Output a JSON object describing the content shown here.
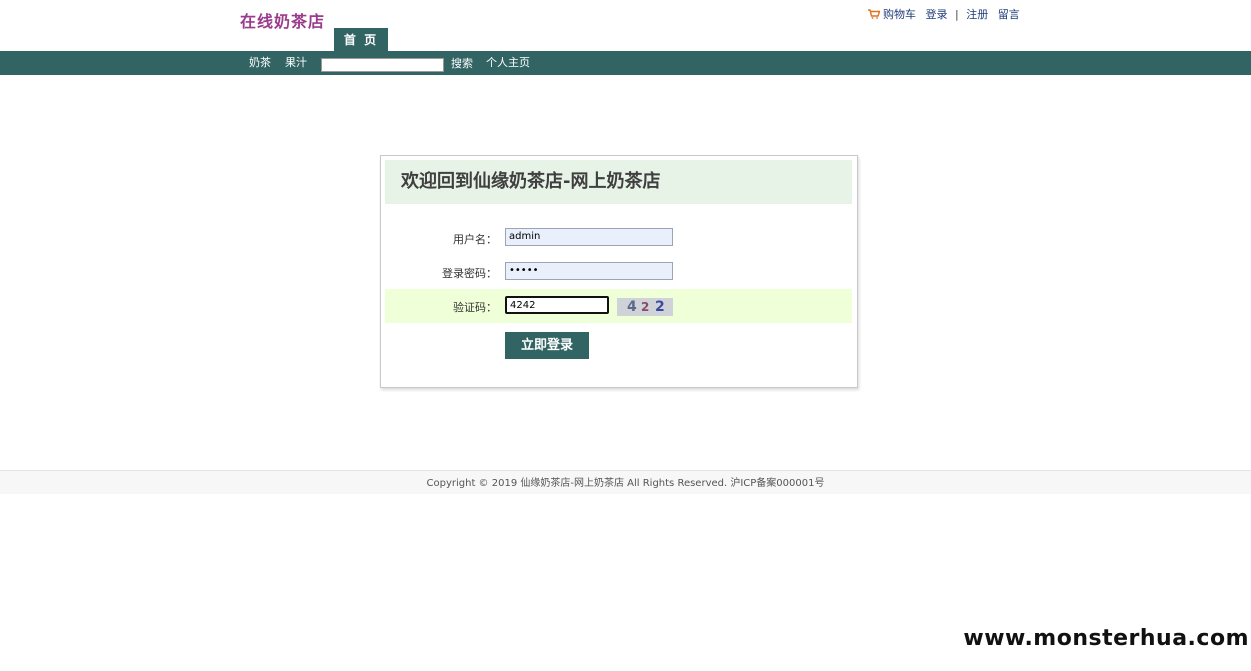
{
  "header": {
    "logo": "在线奶茶店",
    "top_links": {
      "cart": "购物车",
      "login": "登录",
      "separator": "|",
      "register": "注册",
      "message": "留言"
    },
    "home_tab": "首 页"
  },
  "nav": {
    "items": [
      "奶茶",
      "果汁"
    ],
    "search_value": "",
    "search_button": "搜索",
    "profile": "个人主页"
  },
  "login": {
    "title": "欢迎回到仙缘奶茶店-网上奶茶店",
    "username_label": "用户名：",
    "username_value": "admin",
    "password_label": "登录密码：",
    "password_value": "•••••",
    "captcha_label": "验证码：",
    "captcha_value": "4242",
    "captcha_chars": [
      "4",
      "2",
      "2"
    ],
    "submit": "立即登录"
  },
  "footer": {
    "copyright": "Copyright © 2019 仙缘奶茶店-网上奶茶店 All Rights Reserved. 沪ICP备案000001号"
  },
  "watermark": "www.monsterhua.com",
  "colors": {
    "primary": "#326464",
    "logo": "#9b3b8c",
    "header_bg": "#e8f3e8",
    "highlight_row": "#efffd7",
    "cart_icon": "#e07020"
  }
}
